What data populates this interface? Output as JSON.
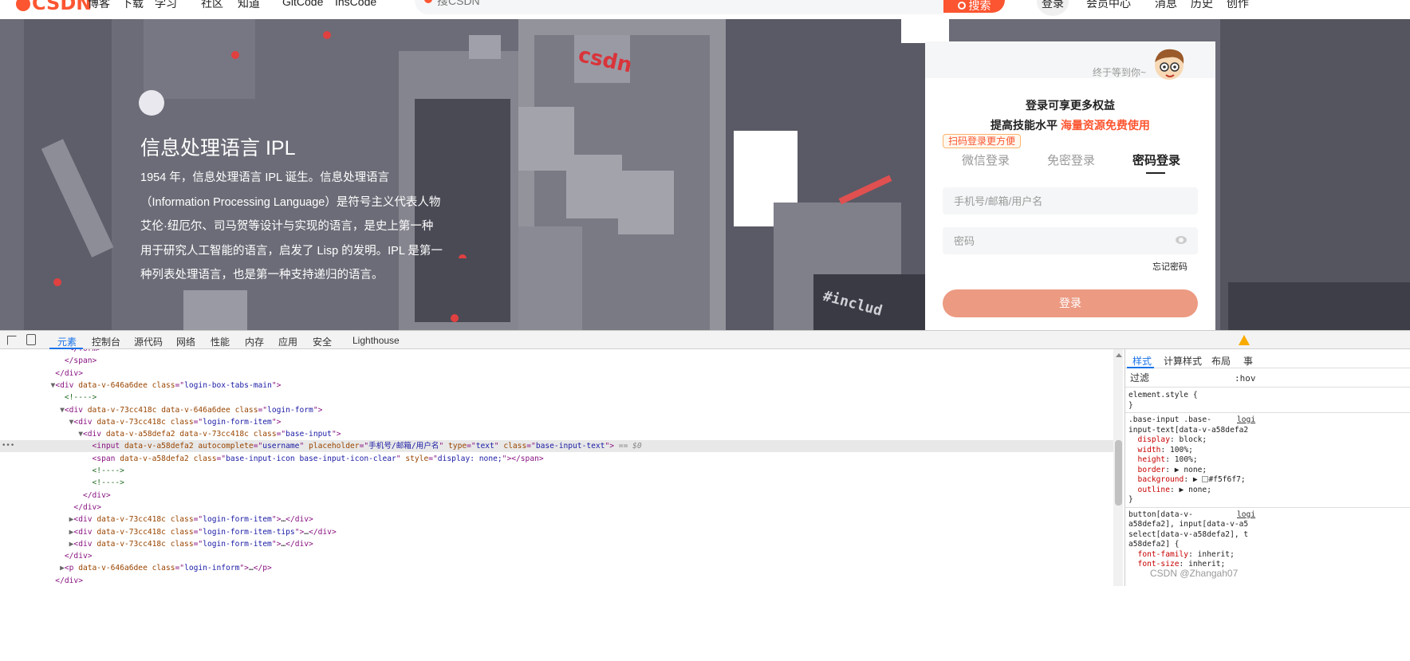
{
  "nav": {
    "logo": "CSDN",
    "items": [
      "博客",
      "下载",
      "学习",
      "社区",
      "知道",
      "GitCode",
      "InsCode"
    ],
    "search_placeholder": "搜CSDN",
    "search_button": "搜索",
    "login": "登录",
    "right_items": [
      "会员中心",
      "消息",
      "历史",
      "创作"
    ]
  },
  "hero": {
    "title": "信息处理语言 IPL",
    "description": "1954 年，信息处理语言 IPL 诞生。信息处理语言（Information Processing Language）是符号主义代表人物艾伦·纽厄尔、司马贺等设计与实现的语言，是史上第一种用于研究人工智能的语言，启发了 Lisp 的发明。IPL 是第一种列表处理语言，也是第一种支持递归的语言。",
    "badge": "csdn",
    "tag": "#includ"
  },
  "login": {
    "greeting": "终于等到你~",
    "promo_line1": "登录可享更多权益",
    "promo_line2_prefix": "提高技能水平",
    "promo_line2_highlight": "海量资源免费使用",
    "qr_tip": "扫码登录更方便",
    "tabs": [
      "微信登录",
      "免密登录",
      "密码登录"
    ],
    "username_placeholder": "手机号/邮箱/用户名",
    "password_placeholder": "密码",
    "forgot": "忘记密码",
    "submit": "登录"
  },
  "devtools": {
    "tabs": [
      "元素",
      "控制台",
      "源代码",
      "网络",
      "性能",
      "内存",
      "应用",
      "安全",
      "Lighthouse"
    ],
    "dom_lines": [
      {
        "indent": 15,
        "arrow": "",
        "html": "</form>"
      },
      {
        "indent": 14,
        "arrow": "",
        "html": "</span>"
      },
      {
        "indent": 12,
        "arrow": "",
        "html": "</div>"
      },
      {
        "indent": 12,
        "arrow": "▼",
        "html": "<div data-v-646a6dee class=\"login-box-tabs-main\">"
      },
      {
        "indent": 14,
        "arrow": "",
        "html": "<!---->"
      },
      {
        "indent": 14,
        "arrow": "▼",
        "html": "<div data-v-73cc418c data-v-646a6dee class=\"login-form\">"
      },
      {
        "indent": 16,
        "arrow": "▼",
        "html": "<div data-v-73cc418c class=\"login-form-item\">"
      },
      {
        "indent": 18,
        "arrow": "▼",
        "html": "<div data-v-a58defa2 data-v-73cc418c class=\"base-input\">"
      },
      {
        "indent": 20,
        "arrow": "",
        "html": "<input data-v-a58defa2 autocomplete=\"username\" placeholder=\"手机号/邮箱/用户名\" type=\"text\" class=\"base-input-text\">",
        "suffix": " == $0"
      },
      {
        "indent": 20,
        "arrow": "",
        "html": "<span data-v-a58defa2 class=\"base-input-icon base-input-icon-clear\" style=\"display: none;\"></span>"
      },
      {
        "indent": 20,
        "arrow": "",
        "html": "<!---->"
      },
      {
        "indent": 20,
        "arrow": "",
        "html": "<!---->"
      },
      {
        "indent": 18,
        "arrow": "",
        "html": "</div>"
      },
      {
        "indent": 16,
        "arrow": "",
        "html": "</div>"
      },
      {
        "indent": 16,
        "arrow": "▶",
        "html": "<div data-v-73cc418c class=\"login-form-item\">…</div>"
      },
      {
        "indent": 16,
        "arrow": "▶",
        "html": "<div data-v-73cc418c class=\"login-form-item-tips\">…</div>"
      },
      {
        "indent": 16,
        "arrow": "▶",
        "html": "<div data-v-73cc418c class=\"login-form-item\">…</div>"
      },
      {
        "indent": 14,
        "arrow": "",
        "html": "</div>"
      },
      {
        "indent": 14,
        "arrow": "▶",
        "html": "<p data-v-646a6dee class=\"login-inform\">…</p>"
      },
      {
        "indent": 12,
        "arrow": "",
        "html": "</div>"
      }
    ],
    "styles_tabs": [
      "样式",
      "计算样式",
      "布局",
      "事"
    ],
    "filter_placeholder": "过滤",
    "hov": ":hov",
    "rules": [
      {
        "selector": "element.style {",
        "lines": [],
        "close": "}"
      },
      {
        "selector": ".base-input .base-",
        "selector2": "input-text[data-v-a58defa2",
        "source": "logi",
        "lines": [
          [
            "display",
            "block;"
          ],
          [
            "width",
            "100%;"
          ],
          [
            "height",
            "100%;"
          ],
          [
            "border",
            "▶ none;"
          ],
          [
            "background",
            "▶ #f5f6f7;"
          ],
          [
            "outline",
            "▶ none;"
          ]
        ],
        "close": "}"
      },
      {
        "selector": "button[data-v-",
        "selector2": "a58defa2], input[data-v-a5",
        "selector3": "select[data-v-a58defa2], t",
        "selector4": "a58defa2] {",
        "source": "logi",
        "lines": [
          [
            "font-family",
            "inherit;"
          ],
          [
            "font-size",
            "inherit;"
          ]
        ],
        "close": ""
      }
    ]
  },
  "watermark": "CSDN @Zhangah07",
  "colors": {
    "brand": "#fc5531",
    "accent": "#1a73e8",
    "login_button": "#ec9a82"
  }
}
